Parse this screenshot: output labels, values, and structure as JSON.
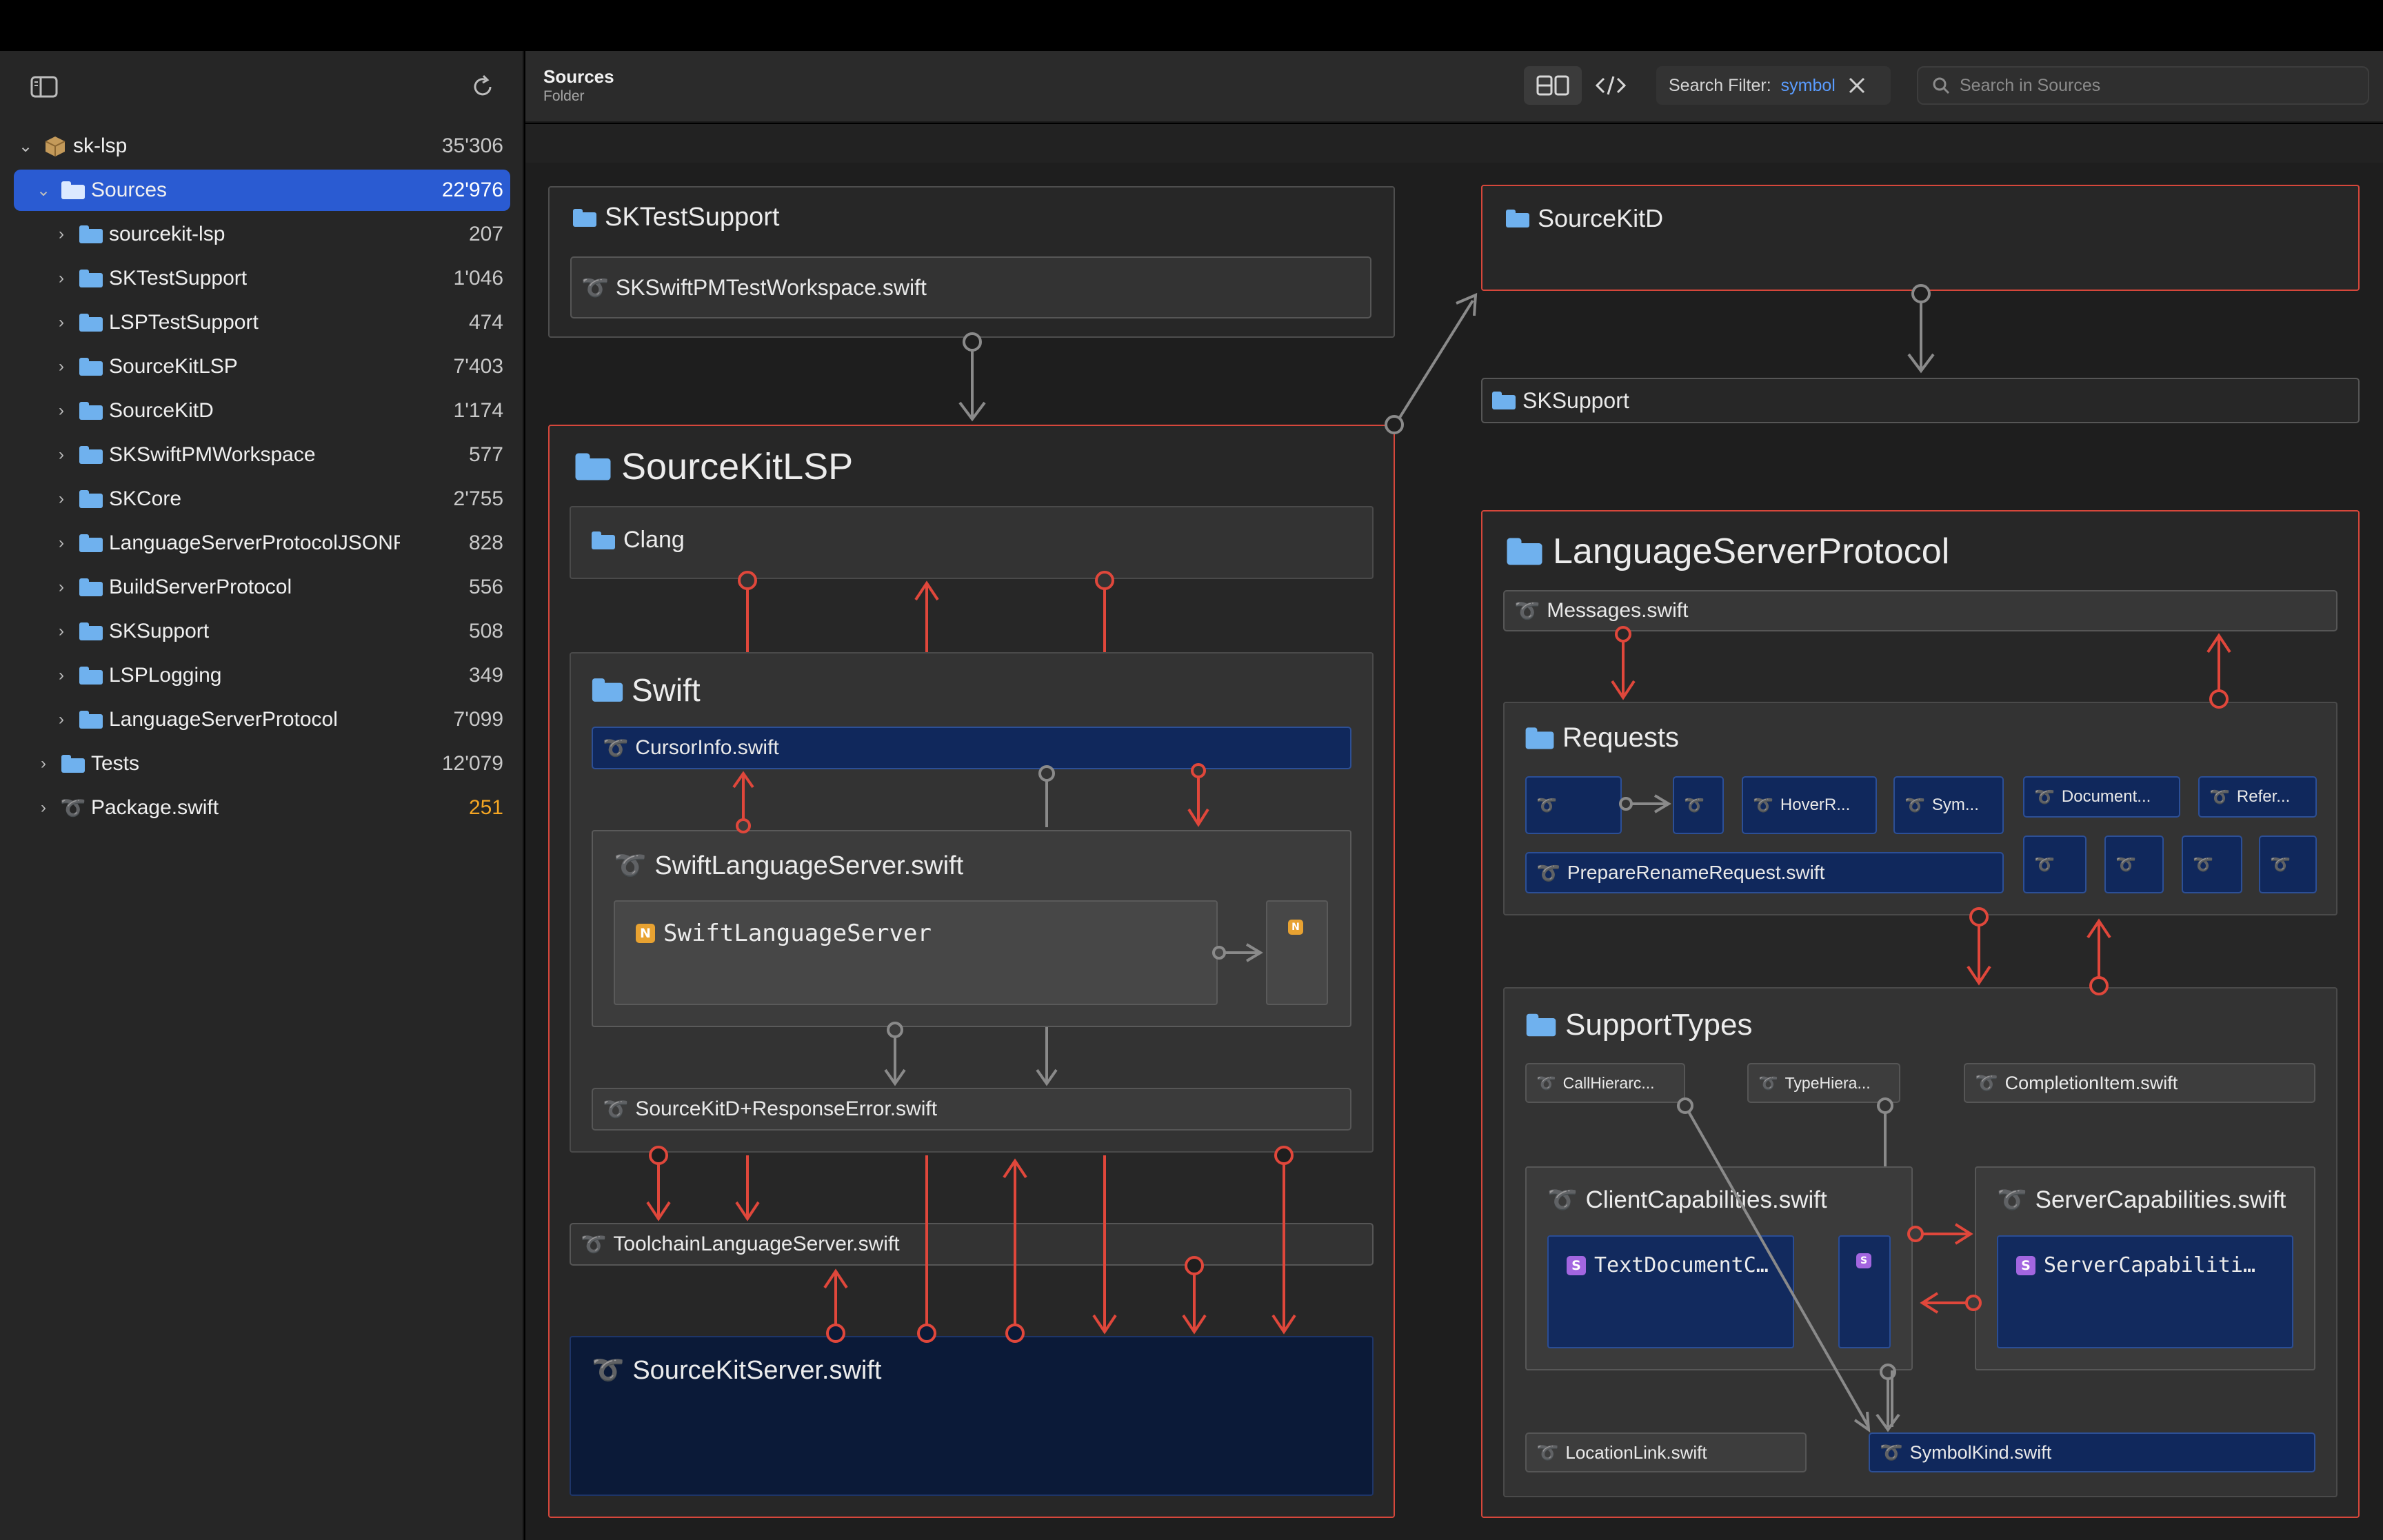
{
  "sidebar": {
    "tree": [
      {
        "label": "sk-lsp",
        "count": "35'306",
        "level": 0,
        "kind": "package",
        "expanded": true
      },
      {
        "label": "Sources",
        "count": "22'976",
        "level": 1,
        "kind": "folder",
        "expanded": true,
        "selected": true
      },
      {
        "label": "sourcekit-lsp",
        "count": "207",
        "level": 2,
        "kind": "folder"
      },
      {
        "label": "SKTestSupport",
        "count": "1'046",
        "level": 2,
        "kind": "folder"
      },
      {
        "label": "LSPTestSupport",
        "count": "474",
        "level": 2,
        "kind": "folder"
      },
      {
        "label": "SourceKitLSP",
        "count": "7'403",
        "level": 2,
        "kind": "folder"
      },
      {
        "label": "SourceKitD",
        "count": "1'174",
        "level": 2,
        "kind": "folder"
      },
      {
        "label": "SKSwiftPMWorkspace",
        "count": "577",
        "level": 2,
        "kind": "folder"
      },
      {
        "label": "SKCore",
        "count": "2'755",
        "level": 2,
        "kind": "folder"
      },
      {
        "label": "LanguageServerProtocolJSONRPC",
        "count": "828",
        "level": 2,
        "kind": "folder"
      },
      {
        "label": "BuildServerProtocol",
        "count": "556",
        "level": 2,
        "kind": "folder"
      },
      {
        "label": "SKSupport",
        "count": "508",
        "level": 2,
        "kind": "folder"
      },
      {
        "label": "LSPLogging",
        "count": "349",
        "level": 2,
        "kind": "folder"
      },
      {
        "label": "LanguageServerProtocol",
        "count": "7'099",
        "level": 2,
        "kind": "folder"
      },
      {
        "label": "Tests",
        "count": "12'079",
        "level": 1,
        "kind": "folder"
      },
      {
        "label": "Package.swift",
        "count": "251",
        "level": 1,
        "kind": "swift",
        "warn": true
      }
    ]
  },
  "header": {
    "title": "Sources",
    "subtitle": "Folder",
    "filter_label": "Search Filter:",
    "filter_value": "symbol",
    "search_placeholder": "Search in Sources"
  },
  "diagram": {
    "sktestsupport": {
      "title": "SKTestSupport",
      "file": "SKSwiftPMTestWorkspace.swift"
    },
    "sourcekitd": {
      "title": "SourceKitD"
    },
    "sksupport": {
      "title": "SKSupport"
    },
    "sourcekitlsp": {
      "title": "SourceKitLSP",
      "clang": "Clang",
      "swift": {
        "title": "Swift",
        "cursorinfo": "CursorInfo.swift",
        "server_file": "SwiftLanguageServer.swift",
        "server_type": "SwiftLanguageServer",
        "response_error": "SourceKitD+ResponseError.swift"
      },
      "toolchain": "ToolchainLanguageServer.swift",
      "server": "SourceKitServer.swift"
    },
    "lsp": {
      "title": "LanguageServerProtocol",
      "messages": "Messages.swift",
      "requests": {
        "title": "Requests",
        "hover": "HoverR...",
        "sym": "Sym...",
        "document": "Document...",
        "refer": "Refer...",
        "prepare_rename": "PrepareRenameRequest.swift"
      },
      "supporttypes": {
        "title": "SupportTypes",
        "callhier": "CallHierarc...",
        "typehier": "TypeHiera...",
        "completion": "CompletionItem.swift",
        "client_caps": "ClientCapabilities.swift",
        "client_type": "TextDocumentC…",
        "server_caps": "ServerCapabilities.swift",
        "server_type": "ServerCapabiliti…",
        "location": "LocationLink.swift",
        "symbolkind": "SymbolKind.swift"
      }
    }
  },
  "colors": {
    "accent": "#2a5bd2",
    "dependency_red": "#e0473b",
    "dependency_gray": "#8a8a8a",
    "swift_orange": "#f58a4b"
  }
}
